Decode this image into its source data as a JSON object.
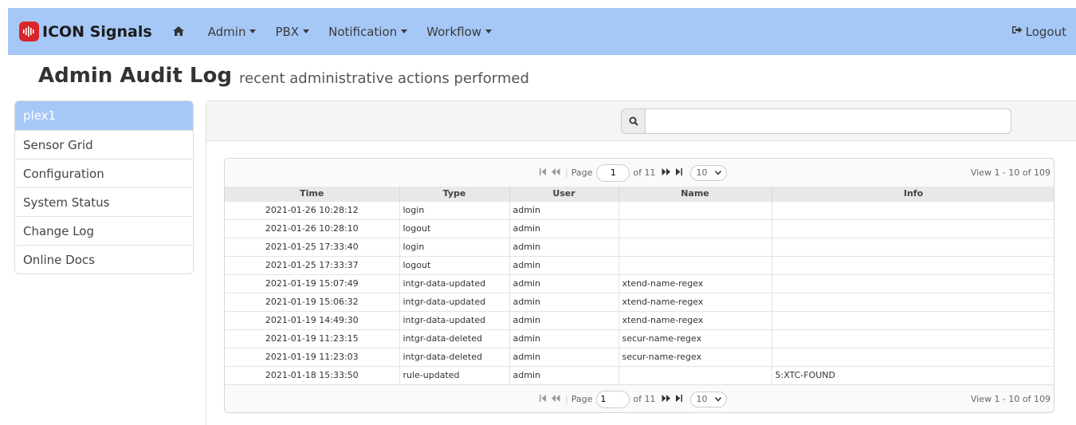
{
  "nav": {
    "brand": "ICON Signals",
    "items": [
      {
        "label": "Admin"
      },
      {
        "label": "PBX"
      },
      {
        "label": "Notification"
      },
      {
        "label": "Workflow"
      }
    ],
    "logout": "Logout"
  },
  "page": {
    "title": "Admin Audit Log",
    "subtitle": "recent administrative actions performed"
  },
  "sidebar": {
    "items": [
      {
        "label": "plex1",
        "active": true
      },
      {
        "label": "Sensor Grid"
      },
      {
        "label": "Configuration"
      },
      {
        "label": "System Status"
      },
      {
        "label": "Change Log"
      },
      {
        "label": "Online Docs"
      }
    ]
  },
  "search": {
    "value": ""
  },
  "pager": {
    "page_label": "Page",
    "page_value": "1",
    "of_label": "of 11",
    "page_size": "10",
    "view_text": "View 1 - 10 of 109"
  },
  "table": {
    "columns": [
      "Time",
      "Type",
      "User",
      "Name",
      "Info"
    ],
    "rows": [
      [
        "2021-01-26 10:28:12",
        "login",
        "admin",
        "",
        ""
      ],
      [
        "2021-01-26 10:28:10",
        "logout",
        "admin",
        "",
        ""
      ],
      [
        "2021-01-25 17:33:40",
        "login",
        "admin",
        "",
        ""
      ],
      [
        "2021-01-25 17:33:37",
        "logout",
        "admin",
        "",
        ""
      ],
      [
        "2021-01-19 15:07:49",
        "intgr-data-updated",
        "admin",
        "xtend-name-regex",
        ""
      ],
      [
        "2021-01-19 15:06:32",
        "intgr-data-updated",
        "admin",
        "xtend-name-regex",
        ""
      ],
      [
        "2021-01-19 14:49:30",
        "intgr-data-updated",
        "admin",
        "xtend-name-regex",
        ""
      ],
      [
        "2021-01-19 11:23:15",
        "intgr-data-deleted",
        "admin",
        "secur-name-regex",
        ""
      ],
      [
        "2021-01-19 11:23:03",
        "intgr-data-deleted",
        "admin",
        "secur-name-regex",
        ""
      ],
      [
        "2021-01-18 15:33:50",
        "rule-updated",
        "admin",
        "",
        "5:XTC-FOUND"
      ]
    ]
  },
  "colors": {
    "navbar": "#a6c8f7",
    "brand_logo": "#d9262b",
    "active_sidebar": "#a6c8f7"
  },
  "icons": {
    "brand": "signal-wave-icon",
    "home": "home-icon",
    "logout": "sign-out-icon",
    "search": "search-icon",
    "pager_first": "first-page-icon",
    "pager_prev": "prev-page-icon",
    "pager_next": "next-page-icon",
    "pager_last": "last-page-icon"
  }
}
